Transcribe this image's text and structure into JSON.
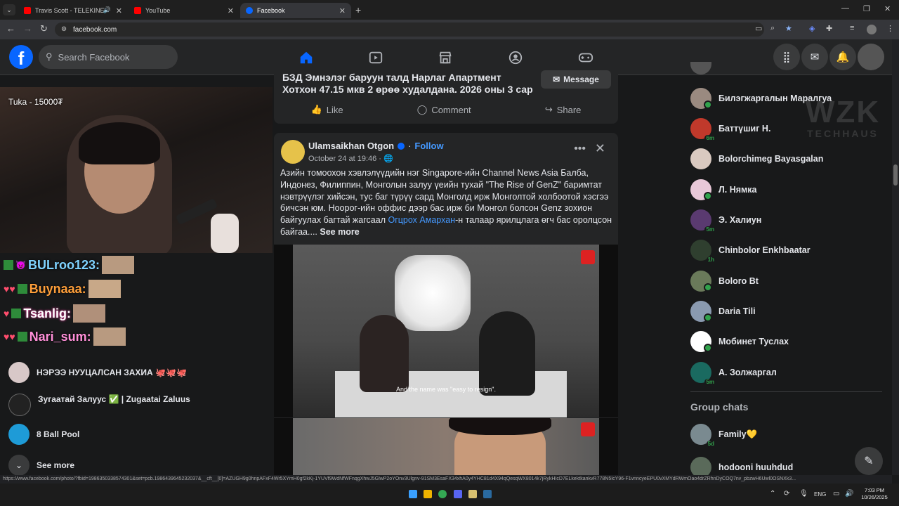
{
  "browser": {
    "tabs": [
      {
        "title": "Travis Scott - TELEKINESIS (",
        "fav_color": "#ff0000"
      },
      {
        "title": "YouTube",
        "fav_color": "#ff0000"
      },
      {
        "title": "Facebook",
        "fav_color": "#0866ff"
      }
    ],
    "url": "facebook.com",
    "status_url": "https://www.facebook.com/photo/?fbid=1986350338574301&set=pcb.1986439645232037&__cft__[0]=AZUGH9g0hnpAFxF4Wr5XYmH0gf2kKj-1YUVf9WdNfWFnqgXhwJ5GlwP2oYOnv3Ulgnv-91SM3EsaFX34xhA0y4YHC81d4X94qQesqWX8014k7jRykHIcD7ELkektkankvR778N5IcY96-F1vnncyeEPU0vXMYdRWmOao4drZRhnDyCOQ7nv_pbzwH6Uwl0OSNXk3..."
  },
  "fb": {
    "search_placeholder": "Search Facebook"
  },
  "overlay": {
    "donation": "Tuka - 15000₮",
    "chat": [
      {
        "user": "BULroo123:",
        "color": "#7fd3ff"
      },
      {
        "user": "Buynaaa:",
        "color": "#ff9f3a"
      },
      {
        "user": "Tsanlig:",
        "color": "#ffffff"
      },
      {
        "user": "Nari_sum:",
        "color": "#ff8fd8"
      }
    ]
  },
  "left_shortcuts": [
    {
      "label": "НЭРЭЭ НУУЦАЛСАН ЗАХИА 🐙🐙🐙",
      "color": "#d8c8c8"
    },
    {
      "label": "Зугаатай Залуус ✅ | Zugaatai Zaluus",
      "color": "#222"
    },
    {
      "label": "8 Ball Pool",
      "color": "#1e9bd7"
    }
  ],
  "see_more": "See more",
  "post1": {
    "text": "БЗД Эмнэлэг баруун талд Нарлаг Апартмент Хотхон 47.15 мкв 2 өрөө худалдана. 2026 оны 3 сар",
    "message_label": "Message",
    "like": "Like",
    "comment": "Comment",
    "share": "Share"
  },
  "post2": {
    "author": "Ulamsaikhan Otgon",
    "follow": "Follow",
    "time": "October 24 at 19:46 · ",
    "text": "Азийн томоохон хэвлэлүүдийн нэг Singapore-ийн Channel News Asia Балба, Индонез, Филиппин, Монголын залуу үеийн тухай \"The Rise of GenZ\" баримтат нэвтрүүлэг хийсэн, тус баг түрүү сард Монголд ирж Монголтой холбоотой хэсгээ бичсэн юм. Ноорог-ийн оффис дээр бас ирж би Монгол болсон Genz зохион байгуулах багтай жагсаал ",
    "mention": "Огцрох Амархан",
    "text_after": "-н талаар ярилцлага өгч бас оролцсон байгаа.... ",
    "see_more": "See more",
    "subtitle": "And the name was \"easy to resign\"."
  },
  "contacts": [
    {
      "name": "Билэгжаргалын Маралгуа",
      "color": "#9a8a80",
      "status": "online"
    },
    {
      "name": "Баттүшиг Н.",
      "color": "#c0392b",
      "status": "6m"
    },
    {
      "name": "Bolorchimeg Bayasgalan",
      "color": "#d9c9c0",
      "status": ""
    },
    {
      "name": "Л. Нямка",
      "color": "#e8c8d8",
      "status": "online"
    },
    {
      "name": "Э. Халиун",
      "color": "#5a3a70",
      "status": "5m"
    },
    {
      "name": "Chinbolor Enkhbaatar",
      "color": "#2f3f2f",
      "status": "1h"
    },
    {
      "name": "Boloro Bt",
      "color": "#6a7a5a",
      "status": "online"
    },
    {
      "name": "Daria Tili",
      "color": "#8a9ab0",
      "status": "online"
    },
    {
      "name": "Мобинет Туслах",
      "color": "#ffffff",
      "status": "online"
    },
    {
      "name": "А. Золжаргал",
      "color": "#1a6a60",
      "status": "5m"
    }
  ],
  "group_chats_heading": "Group chats",
  "groups": [
    {
      "name": "Family💛",
      "color": "#7a8a90",
      "status": "5d"
    },
    {
      "name": "hodooni huuhdud",
      "color": "#5a6a5a",
      "status": ""
    }
  ],
  "watermark": {
    "line1": "WZK",
    "line2": "TECHHAUS"
  },
  "taskbar": {
    "lang": "ENG",
    "time": "7:03 PM",
    "date": "10/26/2025"
  }
}
